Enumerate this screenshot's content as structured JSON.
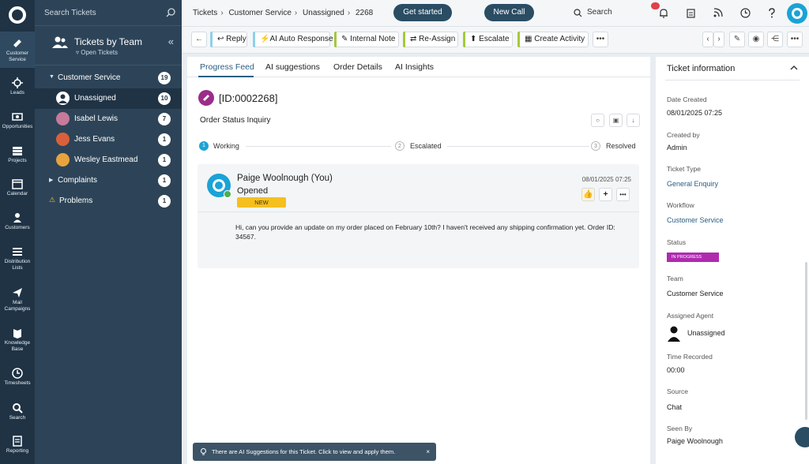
{
  "rail": [
    {
      "label": "Customer Service",
      "icon": "ticket-icon"
    },
    {
      "label": "Leads",
      "icon": "crosshair-icon"
    },
    {
      "label": "Opportunities",
      "icon": "money-icon"
    },
    {
      "label": "Projects",
      "icon": "folder-icon"
    },
    {
      "label": "Calendar",
      "icon": "calendar-icon"
    },
    {
      "label": "Customers",
      "icon": "person-icon"
    },
    {
      "label": "Distribution Lists",
      "icon": "list-icon"
    },
    {
      "label": "Mail Campaigns",
      "icon": "mail-icon"
    },
    {
      "label": "Knowledge Base",
      "icon": "book-icon"
    },
    {
      "label": "Timesheets",
      "icon": "clock-icon"
    },
    {
      "label": "Search",
      "icon": "search-icon"
    },
    {
      "label": "Reporting",
      "icon": "report-icon"
    }
  ],
  "panel": {
    "search_placeholder": "Search Tickets",
    "title": "Tickets by Team",
    "subtitle": "Open Tickets",
    "tree": [
      {
        "label": "Customer Service",
        "count": "19",
        "type": "group"
      },
      {
        "label": "Unassigned",
        "count": "10",
        "type": "member"
      },
      {
        "label": "Isabel Lewis",
        "count": "7",
        "type": "member"
      },
      {
        "label": "Jess Evans",
        "count": "1",
        "type": "member"
      },
      {
        "label": "Wesley Eastmead",
        "count": "1",
        "type": "member"
      },
      {
        "label": "Complaints",
        "count": "1",
        "type": "group"
      },
      {
        "label": "Problems",
        "count": "1",
        "type": "group"
      }
    ]
  },
  "header": {
    "breadcrumbs": [
      "Tickets",
      "Customer Service",
      "Unassigned",
      "2268"
    ],
    "get_started": "Get started",
    "new_call": "New Call",
    "search": "Search"
  },
  "toolbar": {
    "reply": "Reply",
    "ai_auto_response": "AI Auto Response",
    "internal_note": "Internal Note",
    "reassign": "Re-Assign",
    "escalate": "Escalate",
    "create_activity": "Create Activity",
    "more": "•••",
    "accents": {
      "reply": "#8fd0e8",
      "ai": "#8fd0e8",
      "note": "#a3c93a",
      "reassign": "#a3c93a",
      "escalate": "#a3c93a",
      "activity": "#a3c93a"
    }
  },
  "tabs": [
    "Progress Feed",
    "AI suggestions",
    "Order Details",
    "AI Insights"
  ],
  "ticket": {
    "id": "[ID:0002268]",
    "subject": "Order Status Inquiry",
    "steps": [
      {
        "num": "1",
        "label": "Working"
      },
      {
        "num": "2",
        "label": "Escalated"
      },
      {
        "num": "3",
        "label": "Resolved"
      }
    ]
  },
  "feed": {
    "author": "Paige Woolnough (You)",
    "status": "Opened",
    "badge": "NEW",
    "date": "08/01/2025 07:25",
    "message": "Hi, can you provide an update on my order placed on February 10th? I haven't received any shipping confirmation yet. Order ID: 34567."
  },
  "toast": {
    "text": "There are AI Suggestions for this Ticket. Click to view and apply them.",
    "close": "×"
  },
  "info": {
    "title": "Ticket information",
    "fields": [
      {
        "label": "Date Created",
        "value": "08/01/2025 07:25"
      },
      {
        "label": "Created by",
        "value": "Admin"
      },
      {
        "label": "Ticket Type",
        "value": "General Enquiry"
      },
      {
        "label": "Workflow",
        "value": "Customer Service"
      },
      {
        "label": "Status",
        "value": "IN PROGRESS"
      },
      {
        "label": "Team",
        "value": "Customer Service"
      },
      {
        "label": "Assigned Agent",
        "value": "Unassigned"
      },
      {
        "label": "Time Recorded",
        "value": "00:00"
      },
      {
        "label": "Source",
        "value": "Chat"
      },
      {
        "label": "Seen By",
        "value": "Paige Woolnough"
      }
    ]
  }
}
